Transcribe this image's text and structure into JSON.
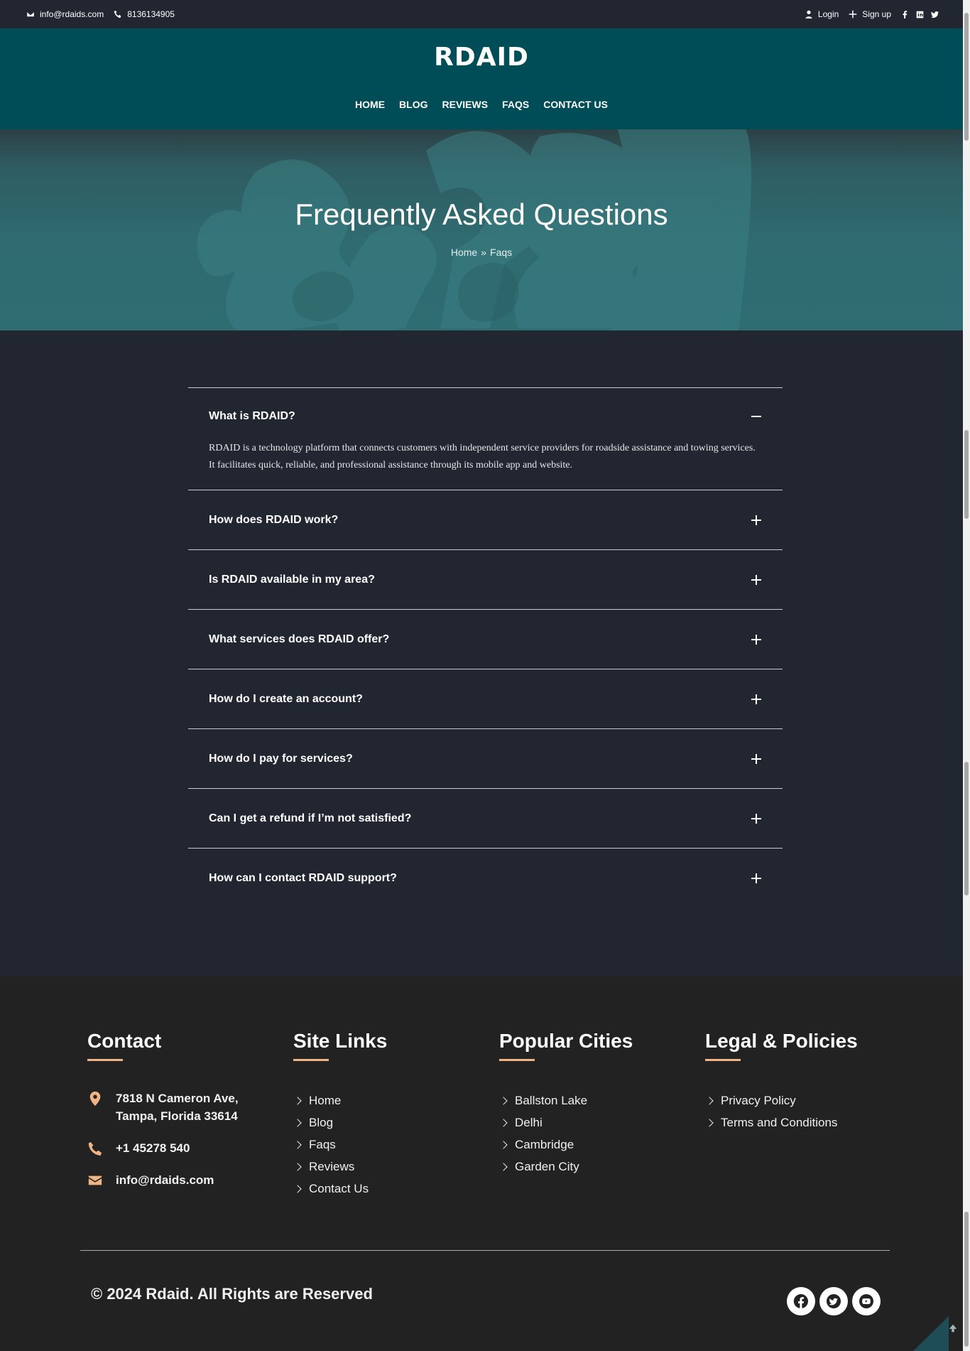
{
  "topbar": {
    "email": "info@rdaids.com",
    "phone": "8136134905",
    "login": "Login",
    "signup": "Sign up"
  },
  "header": {
    "logo": "RDAID",
    "nav": [
      "HOME",
      "BLOG",
      "REVIEWS",
      "FAQS",
      "CONTACT US"
    ]
  },
  "hero": {
    "title": "Frequently Asked Questions",
    "breadcrumb": {
      "home": "Home",
      "sep": "»",
      "current": "Faqs"
    }
  },
  "faq": [
    {
      "q": "What is RDAID?",
      "open": true,
      "a": "RDAID is a technology platform that connects customers with independent service providers for roadside assistance and towing services. It facilitates quick, reliable, and professional assistance through its mobile app and website."
    },
    {
      "q": "How does RDAID work?",
      "open": false
    },
    {
      "q": "Is RDAID available in my area?",
      "open": false
    },
    {
      "q": "What services does RDAID offer?",
      "open": false
    },
    {
      "q": "How do I create an account?",
      "open": false
    },
    {
      "q": "How do I pay for services?",
      "open": false
    },
    {
      "q": "Can I get a refund if I’m not satisfied?",
      "open": false
    },
    {
      "q": "How can I contact RDAID support?",
      "open": false
    }
  ],
  "footer": {
    "contact": {
      "title": "Contact",
      "address_line1": "7818 N Cameron Ave,",
      "address_line2": "Tampa, Florida 33614",
      "phone": "+1 45278 540",
      "email": "info@rdaids.com"
    },
    "site_links": {
      "title": "Site Links",
      "items": [
        "Home",
        "Blog",
        "Faqs",
        "Reviews",
        "Contact Us"
      ]
    },
    "cities": {
      "title": "Popular Cities",
      "items": [
        "Ballston Lake",
        "Delhi",
        "Cambridge",
        "Garden City"
      ]
    },
    "legal": {
      "title": "Legal & Policies",
      "items": [
        "Privacy Policy",
        "Terms and Conditions"
      ]
    },
    "copyright": "© 2024 Rdaid. All Rights are Reserved",
    "social_icons": [
      "facebook-icon",
      "twitter-icon",
      "youtube-icon"
    ]
  },
  "colors": {
    "header_bg": "#014d57",
    "page_bg": "#222630",
    "footer_bg": "#222222",
    "accent": "#f0b383"
  }
}
